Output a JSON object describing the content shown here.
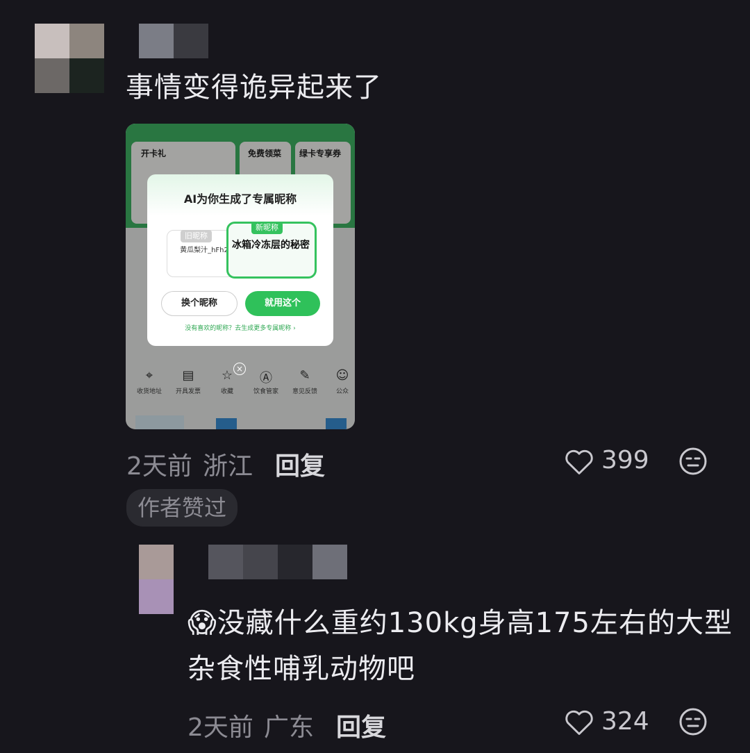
{
  "comment1": {
    "text": "事情变得诡异起来了",
    "time": "2天前",
    "location": "浙江",
    "reply_label": "回复",
    "like_count": "399",
    "author_liked_badge": "作者赞过"
  },
  "screenshot": {
    "top_cards": [
      "开卡礼",
      "免费领菜",
      "绿卡专享券"
    ],
    "dialog": {
      "title": "AI为你生成了专属昵称",
      "old_tag": "旧昵称",
      "old_name": "黄瓜梨汁_hFh2",
      "new_tag": "新昵称",
      "new_name": "冰箱冷冻层的秘密",
      "change_button": "换个昵称",
      "use_button": "就用这个",
      "footer_link": "没有喜欢的昵称？去生成更多专属昵称 ›"
    },
    "menu": [
      "收货地址",
      "开具发票",
      "收藏",
      "饮食管家",
      "意见反馈",
      "公众"
    ],
    "menu_icons": [
      "location-pin-icon",
      "receipt-icon",
      "star-icon",
      "ai-icon",
      "feedback-icon",
      "chat-icon"
    ]
  },
  "comment2": {
    "emoji": "😱",
    "text": "没藏什么重约130kg身高175左右的大型杂食性哺乳动物吧",
    "time": "2天前",
    "location": "广东",
    "reply_label": "回复",
    "like_count": "324"
  }
}
